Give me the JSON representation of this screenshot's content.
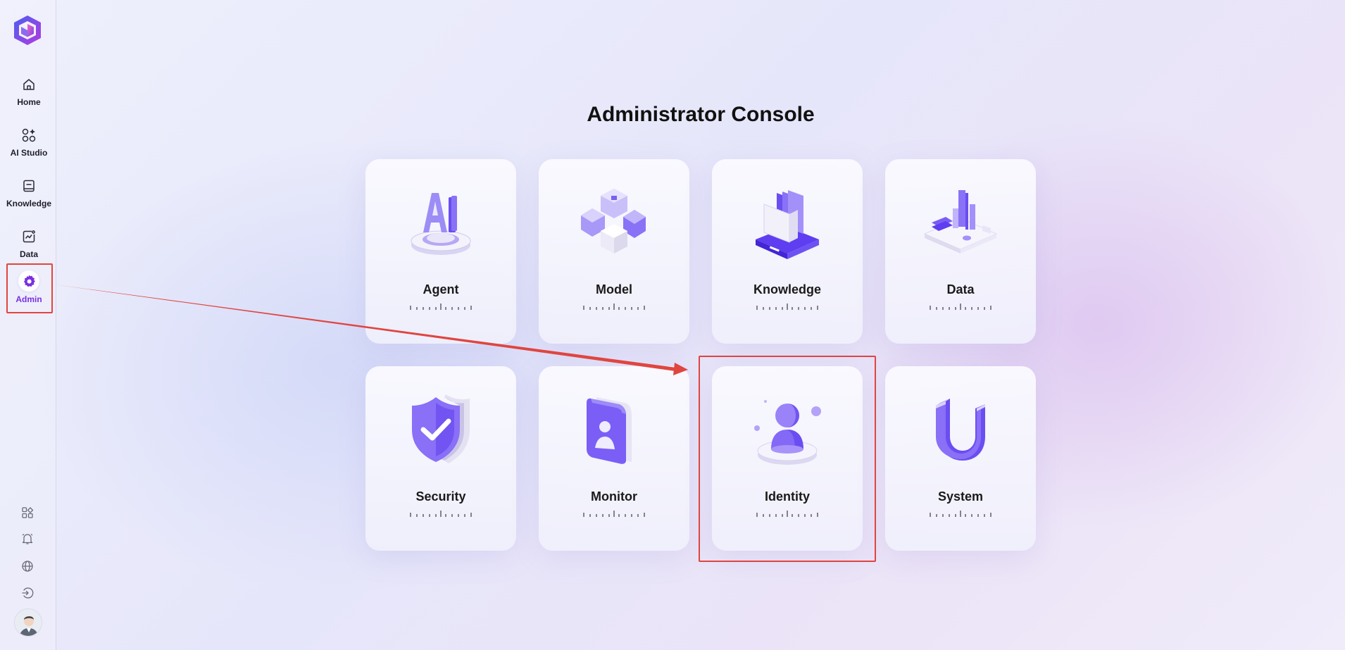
{
  "sidebar": {
    "items": [
      {
        "label": "Home",
        "icon": "home-icon"
      },
      {
        "label": "AI Studio",
        "icon": "ai-studio-icon"
      },
      {
        "label": "Knowledge",
        "icon": "book-icon"
      },
      {
        "label": "Data",
        "icon": "chart-icon"
      },
      {
        "label": "Admin",
        "icon": "gear-icon",
        "active": true
      }
    ],
    "utilities": [
      "apps-icon",
      "bell-icon",
      "globe-icon",
      "logout-icon"
    ]
  },
  "main": {
    "title": "Administrator Console",
    "cards": [
      {
        "label": "Agent",
        "icon": "agent-icon"
      },
      {
        "label": "Model",
        "icon": "model-icon"
      },
      {
        "label": "Knowledge",
        "icon": "knowledge-icon"
      },
      {
        "label": "Data",
        "icon": "data-icon"
      },
      {
        "label": "Security",
        "icon": "security-icon"
      },
      {
        "label": "Monitor",
        "icon": "monitor-icon"
      },
      {
        "label": "Identity",
        "icon": "identity-icon"
      },
      {
        "label": "System",
        "icon": "system-icon"
      }
    ]
  },
  "colors": {
    "accent": "#7a2fe0",
    "card_icon_primary": "#7b5cf5",
    "annotation": "#e0453f"
  }
}
